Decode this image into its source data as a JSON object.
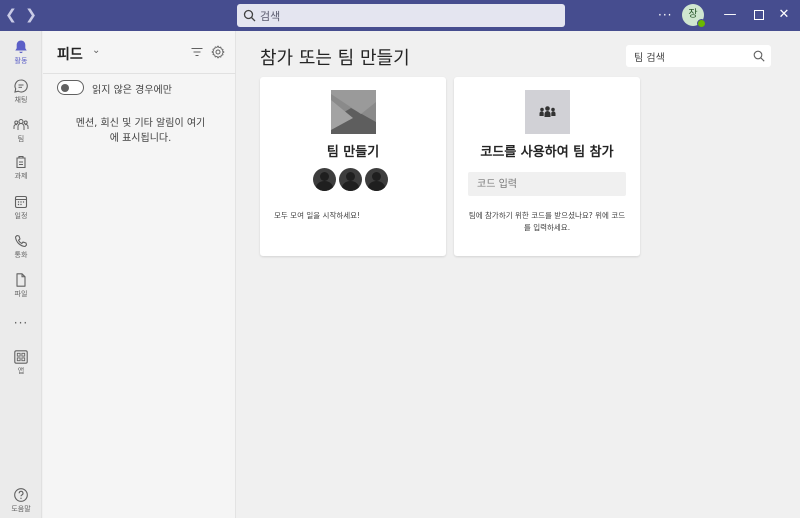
{
  "titlebar": {
    "search_placeholder": "검색",
    "more_label": "···",
    "avatar_initial": "장"
  },
  "rail": {
    "items": [
      {
        "label": "활동",
        "icon": "bell-icon",
        "active": true
      },
      {
        "label": "채팅",
        "icon": "chat-icon"
      },
      {
        "label": "팀",
        "icon": "teams-icon"
      },
      {
        "label": "과제",
        "icon": "assignments-icon"
      },
      {
        "label": "일정",
        "icon": "calendar-icon"
      },
      {
        "label": "통화",
        "icon": "phone-icon"
      },
      {
        "label": "파일",
        "icon": "file-icon"
      },
      {
        "label": "앱",
        "icon": "apps-icon"
      }
    ],
    "more_label": "···",
    "help_label": "도움말"
  },
  "feed": {
    "title": "피드",
    "toggle_label": "읽지 않은 경우에만",
    "empty_message": "멘션, 회신 및 기타 알림이 여기에 표시됩니다."
  },
  "main": {
    "title": "참가 또는 팀 만들기",
    "search_placeholder": "팀 검색",
    "create_card": {
      "title": "팀 만들기",
      "description": "모두 모여 일을 시작하세요!"
    },
    "join_card": {
      "title": "코드를 사용하여 팀 참가",
      "input_placeholder": "코드 입력",
      "description": "팀에 참가하기 위한 코드를 받으셨나요? 위에 코드를 입력하세요."
    }
  },
  "colors": {
    "titlebar": "#464d8f",
    "accent": "#5b5fc7",
    "presence": "#6bb700"
  }
}
